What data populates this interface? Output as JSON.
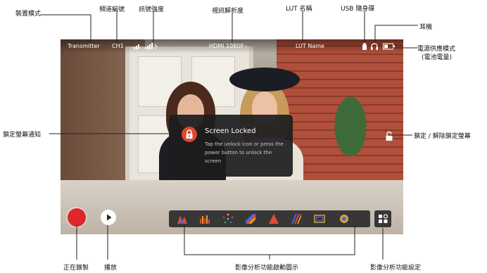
{
  "callouts": {
    "device_mode": "裝置模式",
    "channel": "頻道編號",
    "signal": "訊號強度",
    "resolution": "視訊解析度",
    "lut_name": "LUT 名稱",
    "usb": "USB 隨身碟",
    "headphone": "耳機",
    "power_mode_1": "電源供應模式",
    "power_mode_2": "(電池電量)",
    "lock_notice": "鎖定螢幕通知",
    "lock_unlock": "鎖定 / 解除鎖定螢幕",
    "recording": "正在錄製",
    "playback": "播放",
    "analysis_icons": "影像分析功能啟動圖示",
    "analysis_settings": "影像分析功能設定"
  },
  "status_bar": {
    "mode": "Transmitter",
    "channel": "CH1",
    "resolution": "HDMI 1080P",
    "lut": "LUT Name"
  },
  "lock_popup": {
    "title": "Screen Locked",
    "body": "Tap the unlock icon or press the power button to unlock the screen"
  },
  "colors": {
    "record": "#e0262a",
    "lock_accent": "#e2452f"
  },
  "icons": {
    "analysis": [
      "waveform-icon",
      "histogram-icon",
      "vectorscope-icon",
      "false-color-icon",
      "exposure-icon",
      "zebra-icon",
      "frame-guide-icon",
      "focus-assist-icon"
    ]
  }
}
